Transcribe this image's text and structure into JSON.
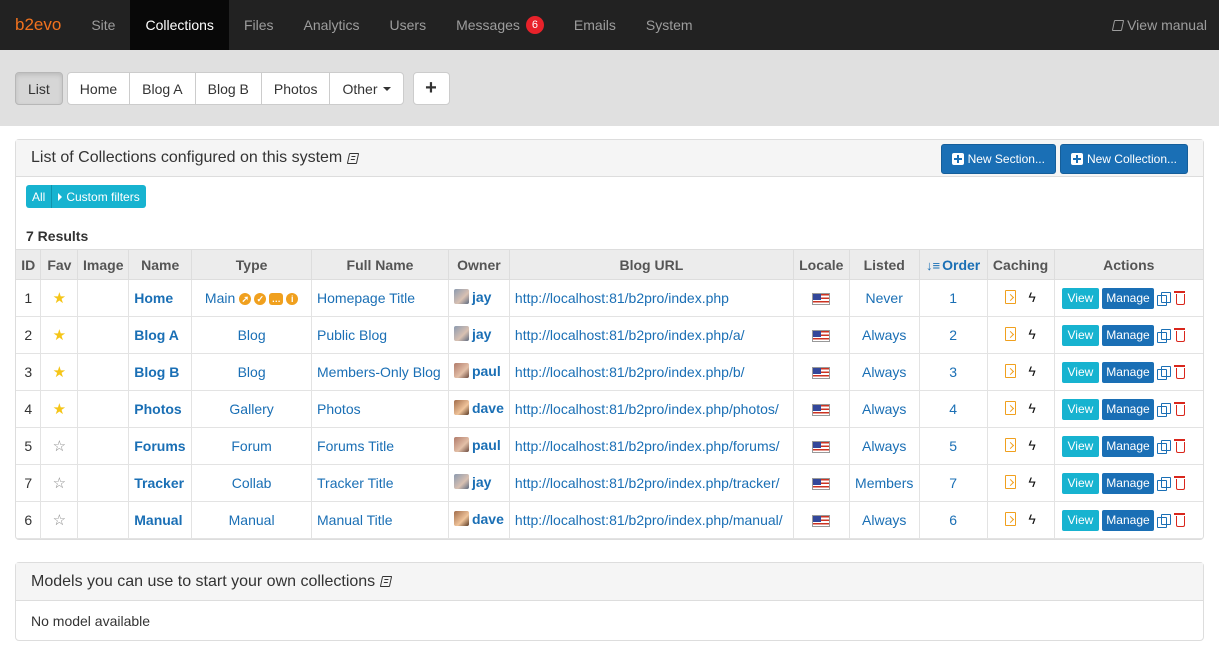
{
  "nav": {
    "brand": "b2evo",
    "items": [
      "Site",
      "Collections",
      "Files",
      "Analytics",
      "Users",
      "Messages",
      "Emails",
      "System"
    ],
    "messages_badge": "6",
    "manual": "View manual"
  },
  "tabs": {
    "list": "List",
    "group": [
      "Home",
      "Blog A",
      "Blog B",
      "Photos"
    ],
    "other": "Other",
    "add": "+"
  },
  "collections_panel": {
    "title": "List of Collections configured on this system",
    "new_section": "New Section...",
    "new_collection": "New Collection...",
    "filter_all": "All",
    "filter_custom": "Custom filters",
    "results": "7 Results",
    "columns": [
      "ID",
      "Fav",
      "Image",
      "Name",
      "Type",
      "Full Name",
      "Owner",
      "Blog URL",
      "Locale",
      "Listed",
      "Order",
      "Caching",
      "Actions"
    ],
    "rows": [
      {
        "id": "1",
        "fav": true,
        "name": "Home",
        "type": "Main",
        "full_name": "Homepage Title",
        "owner": "jay",
        "url": "http://localhost:81/b2pro/index.php",
        "listed": "Never",
        "order": "1"
      },
      {
        "id": "2",
        "fav": true,
        "name": "Blog A",
        "type": "Blog",
        "full_name": "Public Blog",
        "owner": "jay",
        "url": "http://localhost:81/b2pro/index.php/a/",
        "listed": "Always",
        "order": "2"
      },
      {
        "id": "3",
        "fav": true,
        "name": "Blog B",
        "type": "Blog",
        "full_name": "Members-Only Blog",
        "owner": "paul",
        "url": "http://localhost:81/b2pro/index.php/b/",
        "listed": "Always",
        "order": "3"
      },
      {
        "id": "4",
        "fav": true,
        "name": "Photos",
        "type": "Gallery",
        "full_name": "Photos",
        "owner": "dave",
        "url": "http://localhost:81/b2pro/index.php/photos/",
        "listed": "Always",
        "order": "4"
      },
      {
        "id": "5",
        "fav": false,
        "name": "Forums",
        "type": "Forum",
        "full_name": "Forums Title",
        "owner": "paul",
        "url": "http://localhost:81/b2pro/index.php/forums/",
        "listed": "Always",
        "order": "5"
      },
      {
        "id": "7",
        "fav": false,
        "name": "Tracker",
        "type": "Collab",
        "full_name": "Tracker Title",
        "owner": "jay",
        "url": "http://localhost:81/b2pro/index.php/tracker/",
        "listed": "Members",
        "order": "7"
      },
      {
        "id": "6",
        "fav": false,
        "name": "Manual",
        "type": "Manual",
        "full_name": "Manual Title",
        "owner": "dave",
        "url": "http://localhost:81/b2pro/index.php/manual/",
        "listed": "Always",
        "order": "6"
      }
    ],
    "view_label": "View",
    "manage_label": "Manage"
  },
  "models_panel": {
    "title": "Models you can use to start your own collections",
    "empty": "No model available"
  },
  "colors": {
    "accent": "#1a6fb5",
    "info": "#17b3d0",
    "brand": "#f0721e",
    "star": "#f5c518",
    "danger": "#d9261c"
  }
}
